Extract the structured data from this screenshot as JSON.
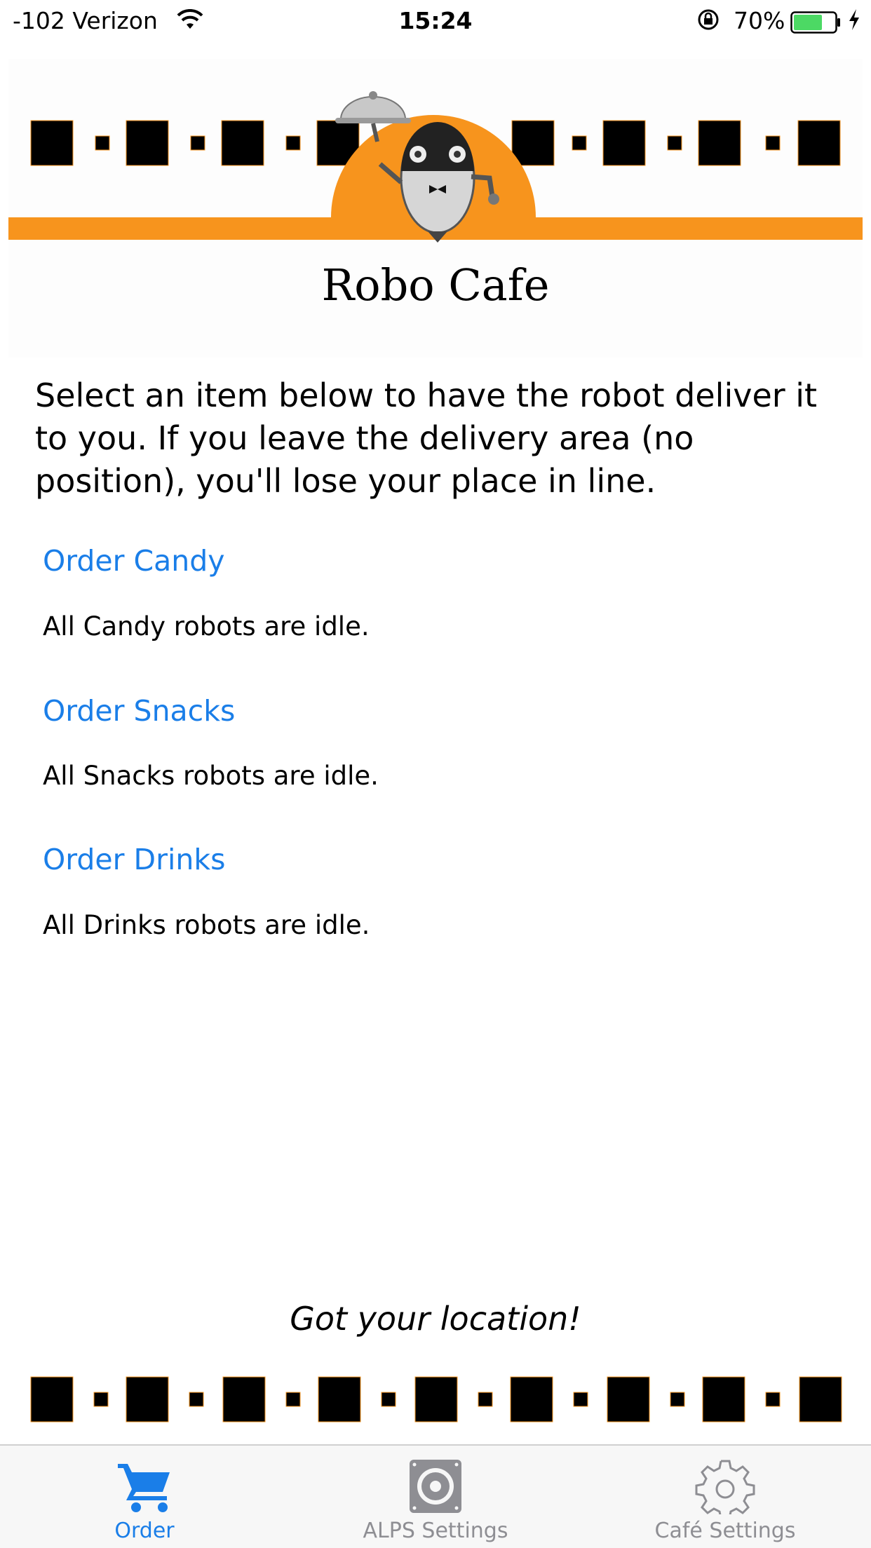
{
  "status_bar": {
    "carrier": "-102 Verizon",
    "time": "15:24",
    "battery_percent": "70%",
    "battery_level": 0.7,
    "icons": [
      "wifi-icon",
      "orientation-lock-icon",
      "battery-icon",
      "charging-bolt-icon"
    ]
  },
  "header": {
    "title": "Robo Cafe",
    "logo": "robot-waiter-logo",
    "accent_color": "#f7941d"
  },
  "description": "Select an item below to have the robot deliver it to you. If you leave the delivery area (no position), you'll lose your place in line.",
  "orders": [
    {
      "label": "Order Candy",
      "status": "All Candy robots are idle."
    },
    {
      "label": "Order Snacks",
      "status": "All Snacks robots are idle."
    },
    {
      "label": "Order Drinks",
      "status": "All Drinks robots are idle."
    }
  ],
  "location_message": "Got your location!",
  "tab_bar": {
    "tabs": [
      {
        "label": "Order",
        "icon": "cart-icon",
        "active": true
      },
      {
        "label": "ALPS Settings",
        "icon": "speaker-icon",
        "active": false
      },
      {
        "label": "Café Settings",
        "icon": "gear-icon",
        "active": false
      }
    ],
    "active_color": "#1a7ee8",
    "inactive_color": "#8e8e93"
  }
}
